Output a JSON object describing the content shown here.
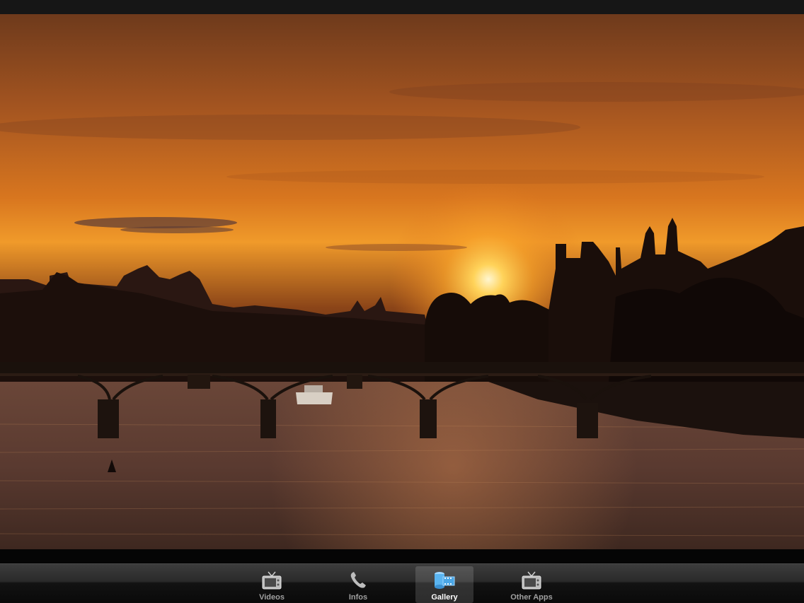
{
  "photo": {
    "subject": "sunset-over-river-with-footbridge"
  },
  "tabbar": {
    "tabs": [
      {
        "label": "Videos",
        "icon": "tv-icon",
        "active": false
      },
      {
        "label": "Infos",
        "icon": "phone-icon",
        "active": false
      },
      {
        "label": "Gallery",
        "icon": "film-reel-icon",
        "active": true
      },
      {
        "label": "Other Apps",
        "icon": "tv-icon",
        "active": false
      }
    ],
    "active_color": "#5ab4f0"
  }
}
